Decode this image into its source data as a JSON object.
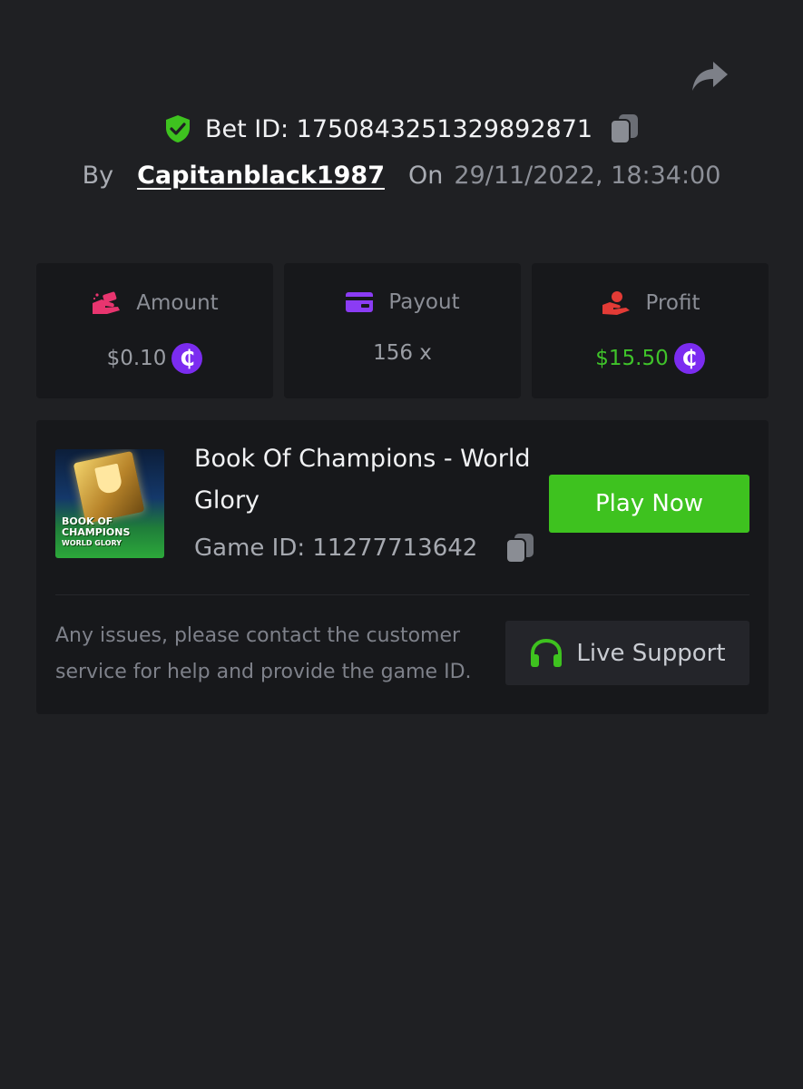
{
  "header": {
    "share_icon": "share-arrow-icon",
    "bet_id_label": "Bet ID: 1750843251329892871",
    "verified_icon": "shield-check-icon",
    "copy_icon": "copy-icon",
    "by_label": "By",
    "username": "Capitanblack1987",
    "on_label": "On",
    "datetime": "29/11/2022, 18:34:00"
  },
  "stats": [
    {
      "label": "Amount",
      "value": "$0.10",
      "icon": "hand-money-icon",
      "icon_color": "#e8356f",
      "has_coin": true,
      "value_color": "#9a9da4"
    },
    {
      "label": "Payout",
      "value": "156 x",
      "icon": "card-icon",
      "icon_color": "#8b3cf4",
      "has_coin": false,
      "value_color": "#9a9da4"
    },
    {
      "label": "Profit",
      "value": "$15.50",
      "icon": "profit-hand-icon",
      "icon_color": "#e33b36",
      "has_coin": true,
      "value_color": "#3fc32a"
    }
  ],
  "coin_symbol": "₵",
  "game": {
    "title": "Book Of Champions - World Glory",
    "thumbnail_text_line1": "BOOK OF",
    "thumbnail_text_line2": "CHAMPIONS",
    "thumbnail_text_line3": "WORLD GLORY",
    "game_id_label": "Game ID: 11277713642",
    "play_button": "Play Now",
    "help_text": "Any issues, please contact the customer service for help and provide the game ID.",
    "support_button": "Live Support",
    "support_icon": "headset-icon"
  },
  "colors": {
    "background": "#1f2023",
    "card": "#17181b",
    "accent_green": "#3ec21f",
    "coin_purple": "#7b2cf0"
  }
}
